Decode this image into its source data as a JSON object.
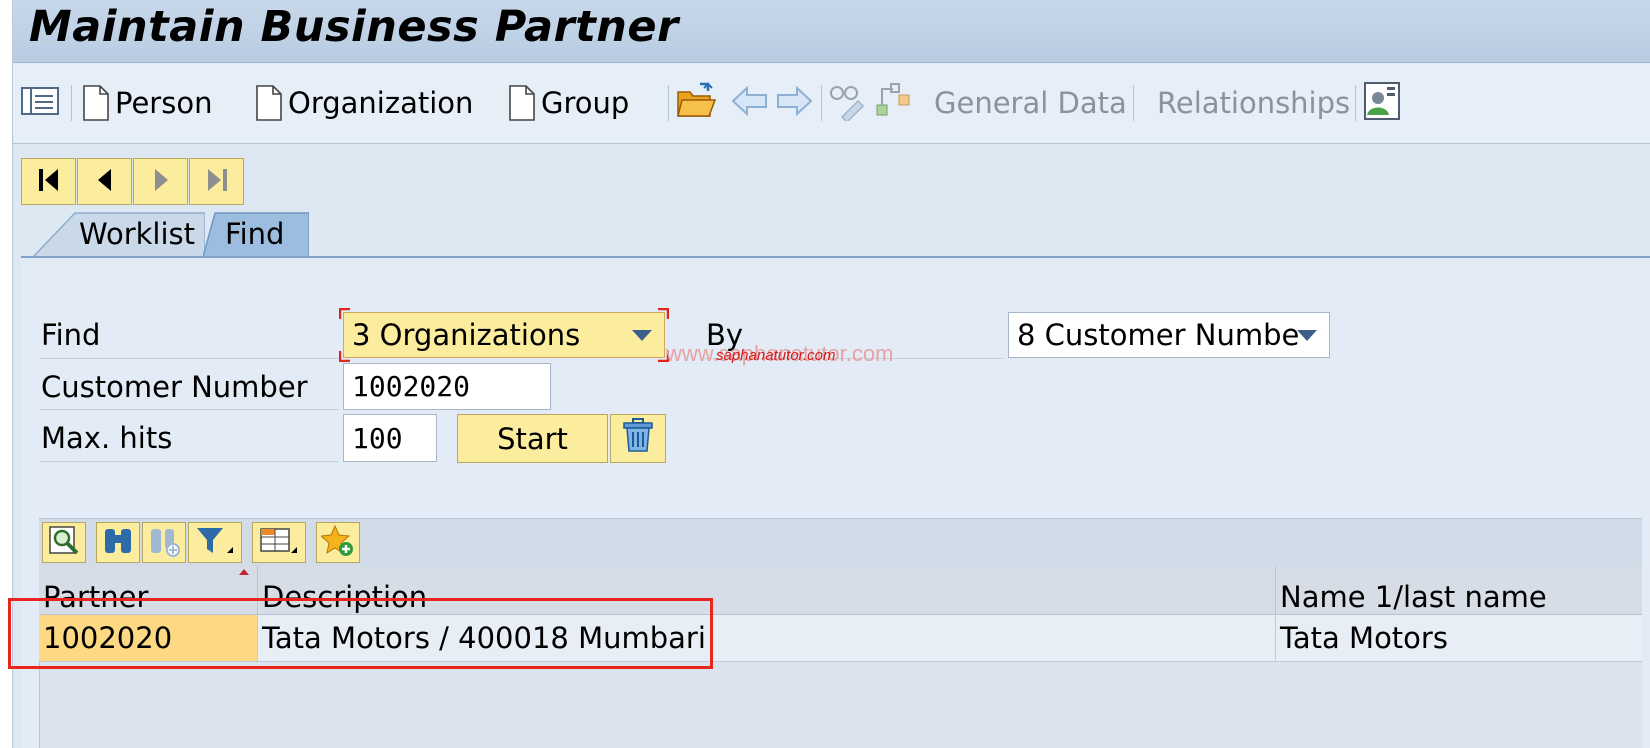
{
  "window": {
    "title": "Maintain Business Partner"
  },
  "toolbar": {
    "person": "Person",
    "organization": "Organization",
    "group": "Group",
    "general_data": "General Data",
    "relationships": "Relationships"
  },
  "tabs": [
    {
      "label": "Worklist",
      "active": false
    },
    {
      "label": "Find",
      "active": true
    }
  ],
  "find_form": {
    "find_label": "Find",
    "find_value": "3 Organizations",
    "by_label": "By",
    "by_value": "8 Customer Numbe",
    "customer_number_label": "Customer Number",
    "customer_number_value": "1002020",
    "max_hits_label": "Max. hits",
    "max_hits_value": "100",
    "start_label": "Start"
  },
  "results": {
    "columns": [
      "Partner",
      "Description",
      "Name 1/last name"
    ],
    "rows": [
      {
        "partner": "1002020",
        "description": "Tata Motors / 400018 Mumbari",
        "name": "Tata Motors"
      }
    ]
  },
  "watermark": {
    "url": "www.saphanatutor.com",
    "brand": "saphanatutor.com"
  },
  "colors": {
    "button_yellow": "#fcec9e",
    "highlight_red": "#e8261c",
    "header_blue": "#b8cce2"
  }
}
